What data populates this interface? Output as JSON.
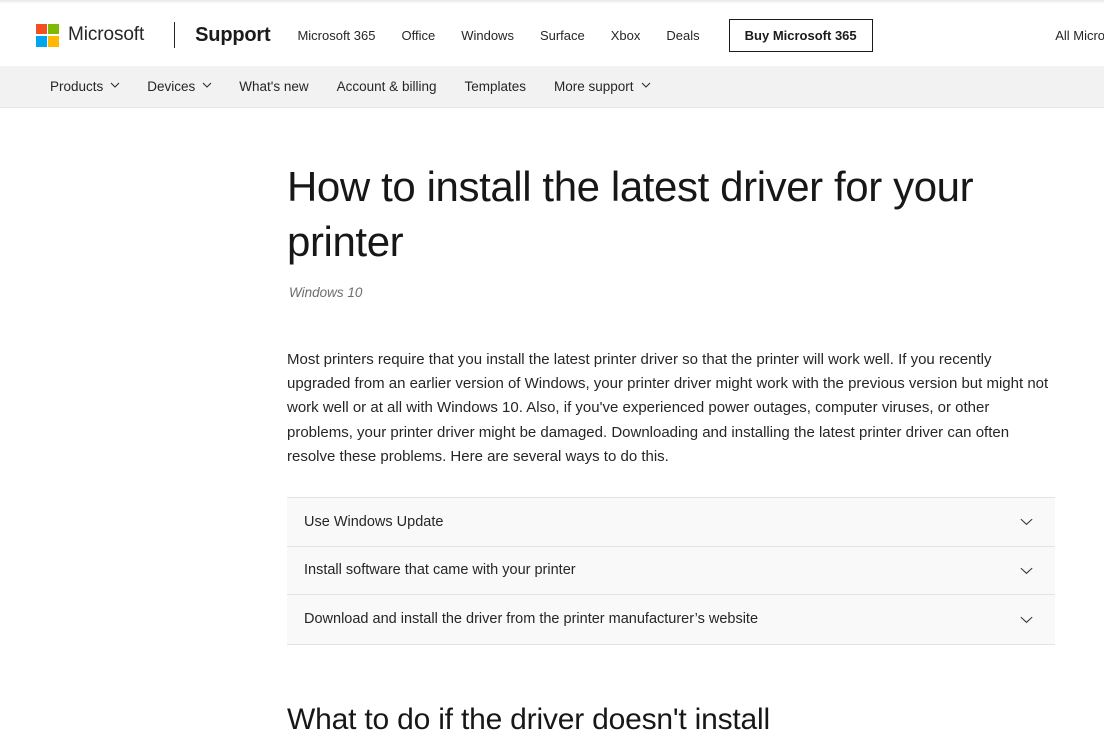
{
  "header": {
    "brand": "Microsoft",
    "logo_colors": {
      "red": "#F25022",
      "green": "#7FBA00",
      "blue": "#00A4EF",
      "yellow": "#FFB900"
    },
    "site_name": "Support",
    "links": [
      {
        "label": "Microsoft 365"
      },
      {
        "label": "Office"
      },
      {
        "label": "Windows"
      },
      {
        "label": "Surface"
      },
      {
        "label": "Xbox"
      },
      {
        "label": "Deals"
      }
    ],
    "buy_button": "Buy Microsoft 365",
    "all_microsoft": "All Microsoft"
  },
  "catnav": {
    "items": [
      {
        "label": "Products",
        "has_chevron": true,
        "icon": "chevron-down-icon"
      },
      {
        "label": "Devices",
        "has_chevron": true,
        "icon": "chevron-down-icon"
      },
      {
        "label": "What's new",
        "has_chevron": false,
        "icon": ""
      },
      {
        "label": "Account & billing",
        "has_chevron": false,
        "icon": ""
      },
      {
        "label": "Templates",
        "has_chevron": false,
        "icon": ""
      },
      {
        "label": "More support",
        "has_chevron": true,
        "icon": "chevron-down-icon"
      }
    ]
  },
  "article": {
    "title": "How to install the latest driver for your printer",
    "applies_to": "Windows 10",
    "intro": "Most printers require that you install the latest printer driver so that the printer will work well. If you recently upgraded from an earlier version of Windows, your printer driver might work with the previous version but might not work well or at all with Windows 10.  Also, if you've experienced power outages, computer viruses, or other problems, your printer driver might be damaged. Downloading and installing the latest printer driver can often resolve these problems. Here are several ways to do this.",
    "accordion": [
      {
        "label": "Use Windows Update",
        "icon": "chevron-down-icon"
      },
      {
        "label": "Install software that came with your printer",
        "icon": "chevron-down-icon"
      },
      {
        "label": "Download and install the driver from the printer manufacturer’s website",
        "icon": "chevron-down-icon"
      }
    ],
    "section_title": "What to do if the driver doesn't install"
  }
}
